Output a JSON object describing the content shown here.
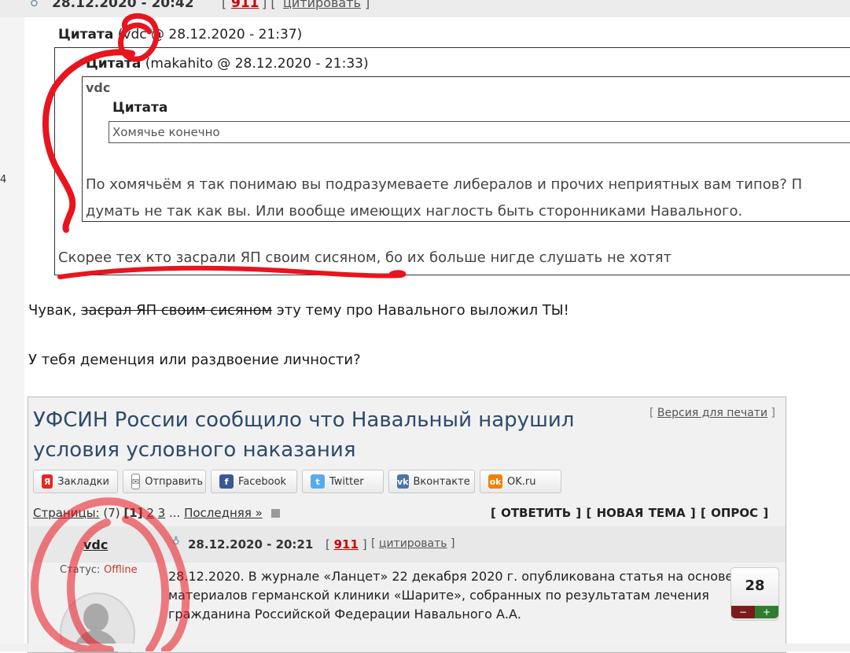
{
  "top_header": {
    "date": "28.12.2020 - 20:42",
    "bracket_open": "[",
    "post_number": "911",
    "bracket_mid": "] [",
    "cite_label": "цитировать",
    "bracket_close": "]"
  },
  "side_number": "4",
  "quote_outer": {
    "label": "Цитата",
    "meta": "(vdc @ 28.12.2020 - 21:37)"
  },
  "quote_inner": {
    "label": "Цитата",
    "meta": "(makahito @ 28.12.2020 - 21:33)",
    "author": "vdc",
    "nested_label": "Цитата",
    "nested_text": "Хомячье конечно",
    "paragraph_line1": "По хомячьём я так понимаю вы подразумеваете либералов и прочих неприятных вам типов? П",
    "paragraph_line2": "думать не так как вы. Или вообще имеющих наглость быть сторонниками Навального."
  },
  "outer_reply": "Скорее тех кто засрали ЯП своим сисяном, бо их больше нигде слушать не хотят",
  "post": {
    "line1_prefix": "Чувак,",
    "line1_struck": "засрал ЯП своим сисяном",
    "line1_suffix": "эту тему про Навального выложил ТЫ!",
    "line2": "У тебя деменция или раздвоение личности?"
  },
  "embedded": {
    "title": "УФСИН России сообщило что Навальный нарушил условия условного наказания",
    "print_link": "Версия для печати",
    "share_buttons": [
      {
        "label": "Закладки",
        "icon": "yandex-icon",
        "color": "#e52620"
      },
      {
        "label": "Отправить",
        "icon": "mail-icon",
        "color": "#ffffff"
      },
      {
        "label": "Facebook",
        "icon": "facebook-icon",
        "color": "#3b5998"
      },
      {
        "label": "Twitter",
        "icon": "twitter-icon",
        "color": "#55acee"
      },
      {
        "label": "Вконтакте",
        "icon": "vk-icon",
        "color": "#4a76a8"
      },
      {
        "label": "OK.ru",
        "icon": "ok-icon",
        "color": "#ee8208"
      }
    ],
    "pages_label": "Страницы:",
    "pages_count": "(7)",
    "page_current": "[1]",
    "page_2": "2",
    "page_3": "3",
    "ellipsis": "...",
    "last_page": "Последняя »",
    "actions": "[ ОТВЕТИТЬ ] [ НОВАЯ ТЕМА ] [ ОПРОС ]",
    "post_author": "vdc",
    "post_date": "28.12.2020 - 20:21",
    "post_number": "911",
    "cite_label": "цитировать",
    "status_label": "Статус:",
    "status_value": "Offline",
    "body_text": "28.12.2020. В журнале «Ланцет» 22 декабря 2020 г. опубликована статья на основе материалов германской клиники «Шарите», собранных по результатам лечения гражданина Российской Федерации Навального А.А.",
    "rating": "28",
    "rating_minus": "−",
    "rating_plus": "+"
  },
  "annotation_color": "#e8141e"
}
